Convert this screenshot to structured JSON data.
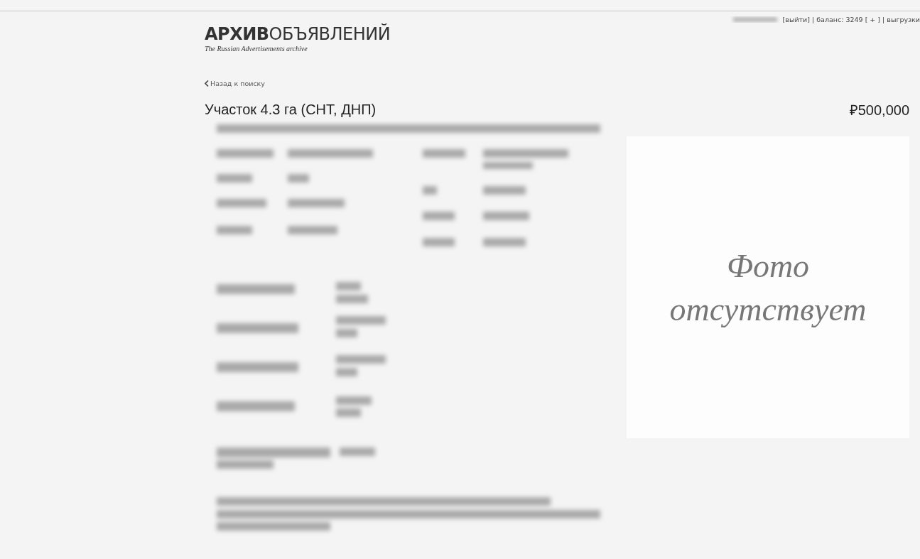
{
  "header": {
    "logo": "**АРХИВ**ОБЪЯВЛЕНИЙ",
    "tagline": "The Russian Advertisements archive",
    "account_links": "[выйти] | баланс: 3249 [ + ] | выгрузки"
  },
  "back_link": "Назад к поиску",
  "listing": {
    "title": "Участок 4.3 га (СНТ, ДНП)",
    "price": "₽500,000",
    "photo_placeholder": [
      "Фото",
      "отсутствует"
    ]
  }
}
